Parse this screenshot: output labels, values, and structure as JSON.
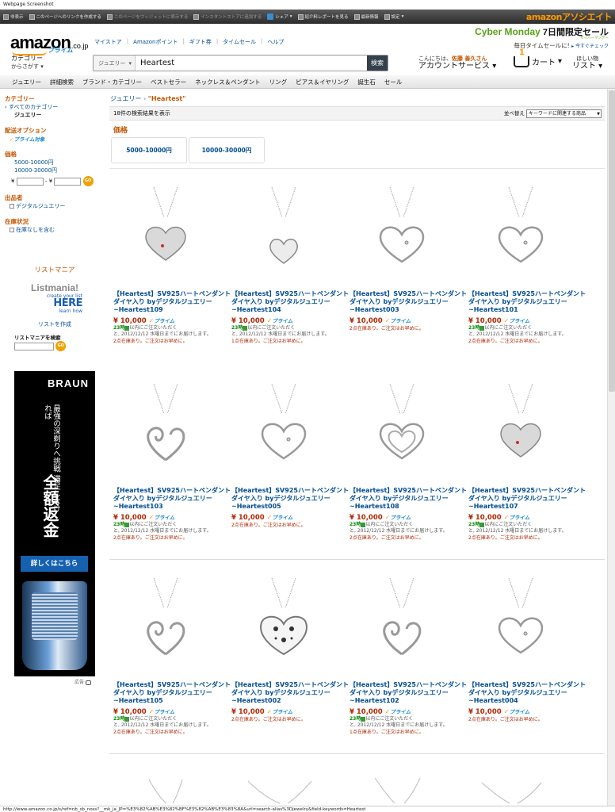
{
  "window": {
    "title": "Webpage Screenshot"
  },
  "toolbar": {
    "items": [
      "非表示",
      "このページへのリンクを作成する",
      "このページをウィジェットに表示する",
      "インスタントストアに追加する",
      "シェア",
      "紹介料レポートを見る",
      "最新情報",
      "設定"
    ],
    "assoc_label": "amazon",
    "assoc_sub": "アソシエイト"
  },
  "header": {
    "logo": "amazon",
    "logo_domain": ".co.jp",
    "logo_prime": "プライム",
    "nav": [
      "マイストア",
      "Amazonポイント",
      "ギフト券",
      "タイムセール",
      "ヘルプ"
    ],
    "cm_title": "Cyber Monday",
    "cm_suffix": "7日間限定セール",
    "cm_sub": "サイバーマンデー",
    "cm_line2": "毎日タイムセールに!",
    "cm_link": "今すぐチェック",
    "category_label": "カテゴリー",
    "category_sub": "からさがす",
    "search_scope": "ジュエリー",
    "search_value": "Heartest",
    "search_button": "検索",
    "greeting": "こんにちは、",
    "user_name": "佐藤 善久さん",
    "account_label": "アカウントサービス",
    "cart_count": "1",
    "cart_label": "カート",
    "wish_line1": "ほしい物",
    "wish_line2": "リスト"
  },
  "subnav": [
    "ジュエリー",
    "詳細検索",
    "ブランド・カテゴリー",
    "ベストセラー",
    "ネックレス＆ペンダント",
    "リング",
    "ピアス＆イヤリング",
    "誕生石",
    "セール"
  ],
  "sidebar": {
    "cat_head": "カテゴリー",
    "cat_all": "‹ すべてのカテゴリー",
    "cat_current": "ジュエリー",
    "ship_head": "配送オプション",
    "ship_prime": "プライム対象",
    "price_head": "価格",
    "price_opts": [
      "5000-10000円",
      "10000-30000円"
    ],
    "yen": "¥",
    "dash": "- ¥",
    "go": "GO",
    "seller_head": "出品者",
    "seller_opt": "デジタルジュエリー",
    "stock_head": "在庫状況",
    "stock_opt": "在庫なしを含む",
    "listmania_title": "リストマニア",
    "lm_word": "Listmania!",
    "lm_create": "create your list",
    "lm_here": "HERE",
    "lm_learn": "learn how",
    "lm_make": "リストを作成",
    "lm_search": "リストマニアを検索",
    "ad_label": "広告"
  },
  "ad": {
    "brand": "BRAUN",
    "copy": "最強の深剃りへ挑戦 満足しなければ",
    "big": "全額返金",
    "cta": "詳しくはこちら"
  },
  "main": {
    "breadcrumb_cat": "ジュエリー",
    "breadcrumb_sep": "›",
    "breadcrumb_q": "\"Heartest\"",
    "result_count": "18件の検索結果を表示",
    "sort_label": "並べ替え",
    "sort_value": "キーワードに関連する商品",
    "price_head": "価格",
    "price_btns": [
      "5000-10000円",
      "10000-30000円"
    ]
  },
  "products": [
    {
      "title": "【Heartest】SV925ハートペンダント ダイヤ入り byデジタルジュエリー~Heartest109",
      "price": "¥ 10,000",
      "prime": "プライム",
      "del1": "23時",
      "del2": "以内にご注文いただく",
      "del3": "と, 2012/12/12 水曜日までにお届けします。",
      "stock": "2点在庫あり。ご注文はお早めに。",
      "shape": "heart-plain"
    },
    {
      "title": "【Heartest】SV925ハートペンダント ダイヤ入り byデジタルジュエリー~Heartest104",
      "price": "¥ 10,000",
      "prime": "プライム",
      "del1": "23時",
      "del2": "以内にご注文いただく",
      "del3": "と, 2012/12/12 水曜日までにお届けします。",
      "stock": "1点在庫あり。ご注文はお早めに。",
      "shape": "heart-drop"
    },
    {
      "title": "【Heartest】SV925ハートペンダント ダイヤ入り byデジタルジュエリー~Heartest003",
      "price": "¥ 10,000",
      "prime": "プライム",
      "del1": "",
      "del2": "",
      "del3": "",
      "stock": "2点在庫あり。ご注文はお早めに。",
      "shape": "heart-open"
    },
    {
      "title": "【Heartest】SV925ハートペンダント ダイヤ入り byデジタルジュエリー~Heartest101",
      "price": "¥ 10,000",
      "prime": "プライム",
      "del1": "23時",
      "del2": "以内にご注文いただく",
      "del3": "と, 2012/12/12 水曜日までにお届けします。",
      "stock": "2点在庫あり。ご注文はお早めに。",
      "shape": "heart-open"
    },
    {
      "title": "【Heartest】SV925ハートペンダント ダイヤ入り byデジタルジュエリー~Heartest103",
      "price": "¥ 10,000",
      "prime": "プライム",
      "del1": "23時",
      "del2": "以内にご注文いただく",
      "del3": "と, 2012/12/12 水曜日までにお届けします。",
      "stock": "2点在庫あり。ご注文はお早めに。",
      "shape": "heart-swirl"
    },
    {
      "title": "【Heartest】SV925ハートペンダント ダイヤ入り byデジタルジュエリー~Heartest005",
      "price": "¥ 10,000",
      "prime": "プライム",
      "del1": "",
      "del2": "",
      "del3": "",
      "stock": "2点在庫あり。ご注文はお早めに。",
      "shape": "heart-open"
    },
    {
      "title": "【Heartest】SV925ハートペンダント ダイヤ入り byデジタルジュエリー~Heartest108",
      "price": "¥ 10,000",
      "prime": "プライム",
      "del1": "23時",
      "del2": "以内にご注文いただく",
      "del3": "と, 2012/12/12 水曜日までにお届けします。",
      "stock": "2点在庫あり。ご注文はお早めに。",
      "shape": "heart-double"
    },
    {
      "title": "【Heartest】SV925ハートペンダント ダイヤ入り byデジタルジュエリー~Heartest107",
      "price": "¥ 10,000",
      "prime": "プライム",
      "del1": "23時",
      "del2": "以内にご注文いただく",
      "del3": "と, 2012/12/12 水曜日までにお届けします。",
      "stock": "2点在庫あり。ご注文はお早めに。",
      "shape": "heart-plain"
    },
    {
      "title": "【Heartest】SV925ハートペンダント ダイヤ入り byデジタルジュエリー~Heartest105",
      "price": "¥ 10,000",
      "prime": "プライム",
      "del1": "23時",
      "del2": "以内にご注文いただく",
      "del3": "と, 2012/12/12 水曜日までにお届けします。",
      "stock": "2点在庫あり。ご注文はお早めに。",
      "shape": "heart-swirl"
    },
    {
      "title": "【Heartest】SV925ハートペンダント ダイヤ入り byデジタルジュエリー~Heartest002",
      "price": "¥ 10,000",
      "prime": "プライム",
      "del1": "",
      "del2": "",
      "del3": "",
      "stock": "2点在庫あり。ご注文はお早めに。",
      "shape": "heart-enamel"
    },
    {
      "title": "【Heartest】SV925ハートペンダント ダイヤ入り byデジタルジュエリー~Heartest102",
      "price": "¥ 10,000",
      "prime": "プライム",
      "del1": "23時",
      "del2": "以内にご注文いただく",
      "del3": "と, 2012/12/12 水曜日までにお届けします。",
      "stock": "1点在庫あり。ご注文はお早めに。",
      "shape": "heart-swirl"
    },
    {
      "title": "【Heartest】SV925ハートペンダント ダイヤ入り byデジタルジュエリー~Heartest004",
      "price": "¥ 10,000",
      "prime": "プライム",
      "del1": "",
      "del2": "",
      "del3": "",
      "stock": "2点在庫あり。ご注文はお早めに。",
      "shape": "heart-open"
    }
  ],
  "status": {
    "url": "http://www.amazon.co.jp/s/ref=nb_sb_noss?__mk_ja_JP=%E3%82%AB%E3%82%BF%E3%82%AB%E3%83%8A&url=search-alias%3Djewelry&field-keywords=Heartest"
  },
  "colors": {
    "accent": "#c45500",
    "link": "#004b91",
    "price": "#b12704",
    "brand": "#ff9900"
  }
}
